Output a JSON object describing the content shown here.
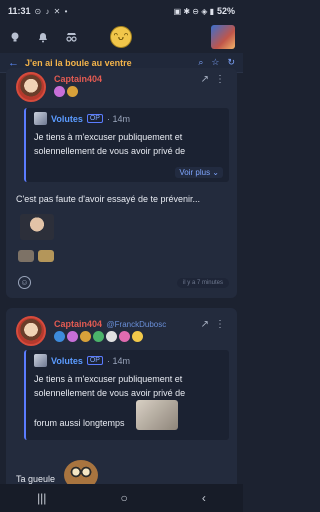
{
  "status": {
    "time": "11:31",
    "left_icons": "⊙ ♪ ✕ •",
    "right_icons": "▣ ✱ ⊖ ◈ ▮",
    "battery": "52%"
  },
  "appbar": {
    "center_emoji": "ᵔᴗᵔ"
  },
  "topic": {
    "back_symbol": "←",
    "title": "J'en ai la boule au ventre",
    "tools": [
      "⌕",
      "☆",
      "↻"
    ]
  },
  "posts": [
    {
      "author": "Captain404",
      "handle": "",
      "share_symbol": "↗",
      "more_symbol": "⋮",
      "quote": {
        "name": "Volutes",
        "op": "OP",
        "time": "· 14m",
        "lines": [
          "Je tiens à m'excuser publiquement et",
          "solennellement de vous avoir privé de"
        ],
        "voir_plus": "Voir plus ⌄"
      },
      "body": "C'est pas faute d'avoir essayé de te prévenir...",
      "time_ago": "il y a 7 minutes"
    },
    {
      "author": "Captain404",
      "handle": "@FranckDubosc",
      "share_symbol": "↗",
      "more_symbol": "⋮",
      "quote": {
        "name": "Volutes",
        "op": "OP",
        "time": "· 14m",
        "lines": [
          "Je tiens à m'excuser publiquement et",
          "solennellement de vous avoir privé de",
          "forum aussi longtemps"
        ]
      },
      "body": "Ta gueule"
    }
  ],
  "nav": [
    "|||",
    "○",
    "‹"
  ],
  "colors": {
    "accent": "#5b7cff",
    "author": "#e35b52",
    "topic_title": "#f2b34a"
  }
}
